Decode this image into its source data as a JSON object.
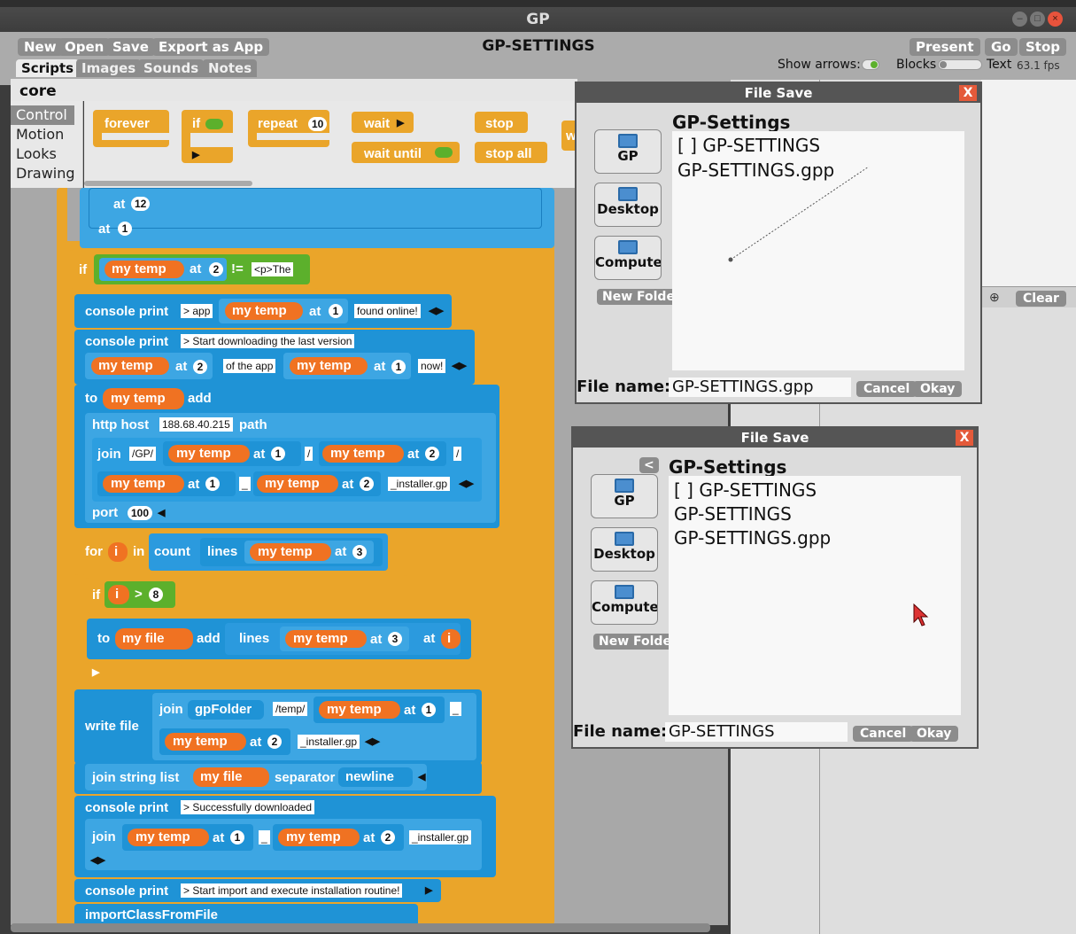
{
  "window": {
    "title": "GP"
  },
  "toolbar": {
    "new": "New",
    "open": "Open",
    "save": "Save",
    "export": "Export as App",
    "project_title": "GP-SETTINGS",
    "present": "Present",
    "go": "Go",
    "stop": "Stop",
    "show_arrows": "Show arrows:",
    "blocks": "Blocks",
    "text": "Text",
    "fps": "63.1 fps"
  },
  "tabs": {
    "scripts": "Scripts",
    "images": "Images",
    "sounds": "Sounds",
    "notes": "Notes"
  },
  "palette": {
    "module": "core",
    "categories": [
      "Control",
      "Motion",
      "Looks",
      "Drawing"
    ],
    "blocks": {
      "forever": "forever",
      "if": "if",
      "repeat": "repeat",
      "repeat_n": "10",
      "wait": "wait",
      "wait_until": "wait until",
      "stop": "stop",
      "stop_all": "stop all",
      "partial": "w"
    }
  },
  "output": {
    "clear": "Clear"
  },
  "script": {
    "at": "at",
    "at_12": "12",
    "n1": "1",
    "n2": "2",
    "n3": "3",
    "n8": "8",
    "port_n": "100",
    "if": "if",
    "my_temp": "my temp",
    "neq": "!=",
    "p_the": "<p>The",
    "console_print": "console print",
    "app_str": "> app",
    "found_online": "found online!",
    "start_dl": "> Start downloading the last version",
    "of_the_app": "of the app",
    "now": "now!",
    "to": "to",
    "add": "add",
    "http_host": "http host",
    "host_ip": "188.68.40.215",
    "path": "path",
    "join": "join",
    "gp_path": "/GP/",
    "slash": "/",
    "underscore": "_",
    "installer_gp": "_installer.gp",
    "port": "port",
    "for": "for",
    "i": "i",
    "in": "in",
    "count": "count",
    "lines": "lines",
    "gt": ">",
    "my_file": "my file",
    "write_file": "write file",
    "gp_folder": "gpFolder",
    "temp_path": "/temp/",
    "join_string_list": "join string list",
    "separator": "separator",
    "newline": "newline",
    "success": "> Successfully downloaded",
    "start_import": "> Start import and execute installation routine!",
    "import_class": "importClassFromFile"
  },
  "dialog1": {
    "title": "File Save",
    "close": "X",
    "folder": "GP-Settings",
    "places": [
      "GP",
      "Desktop",
      "Compute"
    ],
    "new_folder": "New Folder",
    "files": [
      "[ ] GP-SETTINGS",
      "GP-SETTINGS.gpp"
    ],
    "filename_label": "File name:",
    "filename": "GP-SETTINGS.gpp",
    "cancel": "Cancel",
    "okay": "Okay"
  },
  "dialog2": {
    "title": "File Save",
    "close": "X",
    "back": "<",
    "folder": "GP-Settings",
    "places": [
      "GP",
      "Desktop",
      "Compute"
    ],
    "new_folder": "New Folder",
    "files": [
      "[ ] GP-SETTINGS",
      "GP-SETTINGS",
      "GP-SETTINGS.gpp"
    ],
    "filename_label": "File name:",
    "filename": "GP-SETTINGS",
    "cancel": "Cancel",
    "okay": "Okay"
  }
}
